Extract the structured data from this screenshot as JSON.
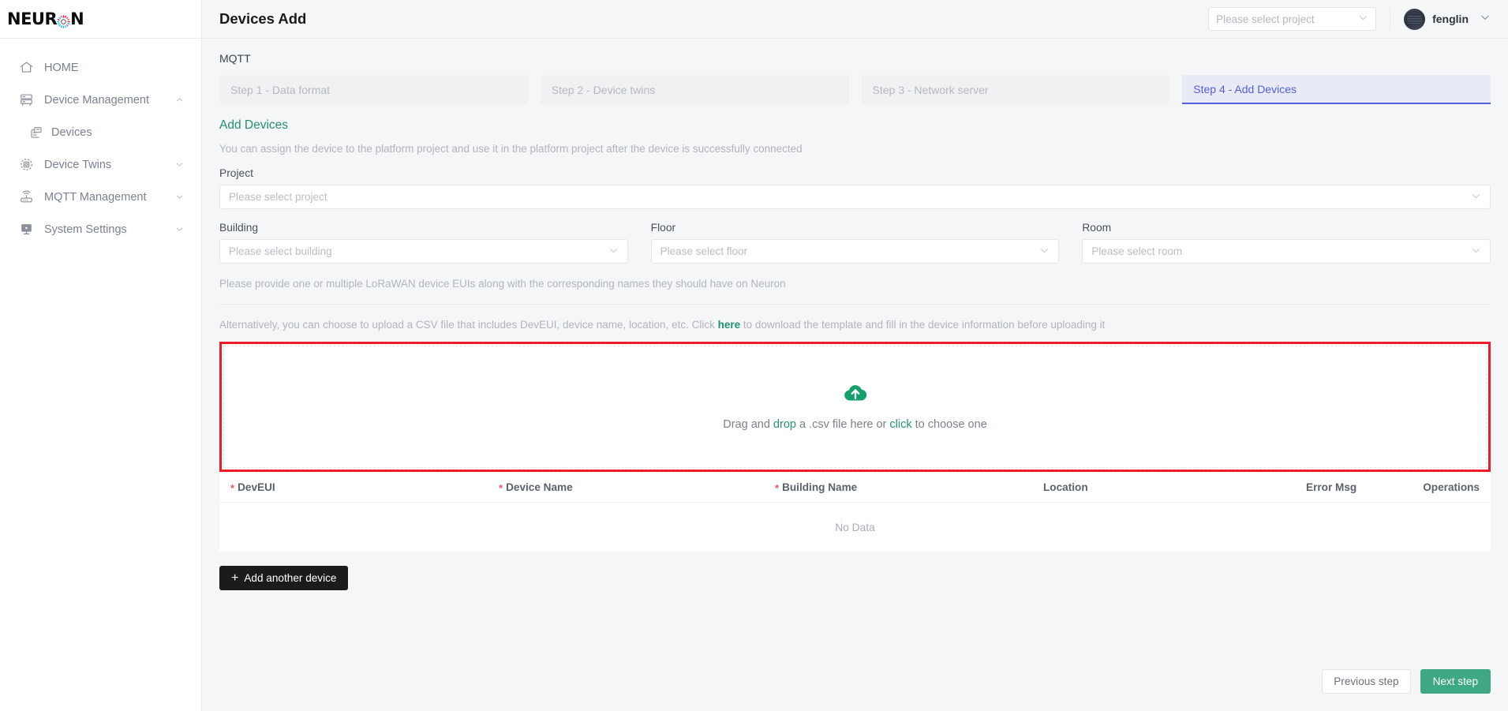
{
  "brand": {
    "name_before": "NEUR",
    "name_after": "N",
    "logo_icon": "neuron-burst-icon",
    "burst_colors": [
      "#e8124a",
      "#16b6e8",
      "#f05a7a",
      "#2bc4f0"
    ]
  },
  "sidebar": {
    "items": [
      {
        "label": "HOME",
        "icon": "home-icon",
        "sub": false,
        "chevron": "none"
      },
      {
        "label": "Device Management",
        "icon": "server-rack-icon",
        "sub": false,
        "chevron": "up"
      },
      {
        "label": "Devices",
        "icon": "device-list-icon",
        "sub": true,
        "chevron": "none"
      },
      {
        "label": "Device Twins",
        "icon": "target-circle-icon",
        "sub": false,
        "chevron": "down"
      },
      {
        "label": "MQTT Management",
        "icon": "router-wifi-icon",
        "sub": false,
        "chevron": "down"
      },
      {
        "label": "System Settings",
        "icon": "monitor-icon",
        "sub": false,
        "chevron": "down"
      }
    ]
  },
  "header": {
    "title": "Devices Add",
    "project_select_placeholder": "Please select project",
    "project_select_value": "",
    "user_name": "fenglin",
    "avatar_icon": "avatar",
    "caret_icon": "chevron-down-icon"
  },
  "main": {
    "protocol_label": "MQTT",
    "steps": [
      {
        "label": "Step 1 - Data format",
        "active": false
      },
      {
        "label": "Step 2 - Device twins",
        "active": false
      },
      {
        "label": "Step 3 - Network server",
        "active": false
      },
      {
        "label": "Step 4 - Add Devices",
        "active": true
      }
    ],
    "section_title": "Add Devices",
    "section_desc": "You can assign the device to the platform project and use it in the platform project after the device is successfully connected",
    "fields": {
      "project_label": "Project",
      "project_placeholder": "Please select project",
      "building_label": "Building",
      "building_placeholder": "Please select building",
      "floor_label": "Floor",
      "floor_placeholder": "Please select floor",
      "room_label": "Room",
      "room_placeholder": "Please select room"
    },
    "note_1": "Please provide one or multiple LoRaWAN device EUIs along with the corresponding names they should have on Neuron",
    "note_2_pre": "Alternatively, you can choose to upload a CSV file that includes DevEUI, device name, location, etc. Click",
    "note_2_link": "here",
    "note_2_post": "to download the template and fill in the device information before uploading it",
    "upload": {
      "icon": "cloud-upload-icon",
      "text_pre": "Drag and ",
      "text_link1": "drop",
      "text_mid": " a .csv file here or ",
      "text_link2": "click",
      "text_post": " to choose one",
      "highlight_color": "#ee1c28"
    },
    "table": {
      "columns": [
        {
          "label": "DevEUI",
          "required": true
        },
        {
          "label": "Device Name",
          "required": true
        },
        {
          "label": "Building Name",
          "required": true
        },
        {
          "label": "Location",
          "required": false
        },
        {
          "label": "Error Msg",
          "required": false
        },
        {
          "label": "Operations",
          "required": false
        }
      ],
      "rows": [],
      "empty_text": "No Data"
    },
    "add_device_button": "Add another device",
    "add_device_icon": "plus-icon"
  },
  "footer": {
    "previous_label": "Previous step",
    "next_label": "Next step",
    "next_color": "#3da883"
  }
}
